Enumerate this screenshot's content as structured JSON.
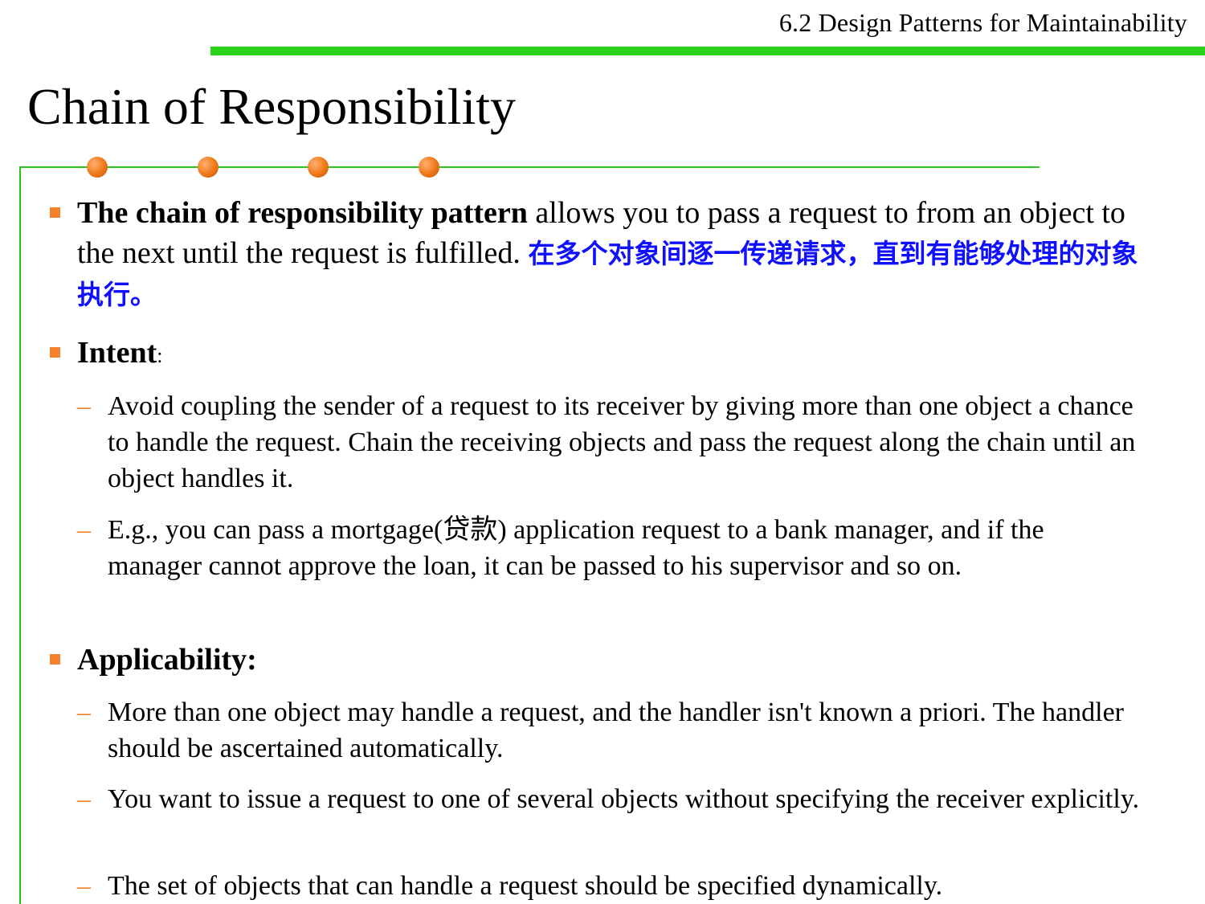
{
  "header": {
    "section": "6.2 Design Patterns for Maintainability",
    "title": "Chain of Responsibility"
  },
  "colors": {
    "accent_green": "#2bd31b",
    "bullet_orange": "#f5822a",
    "chinese_blue": "#1010ff"
  },
  "content": {
    "definition": {
      "bold": "The chain of responsibility pattern",
      "rest": " allows you to pass a request to from an object to the next until the request is fulfilled. ",
      "chinese": "在多个对象间逐一传递请求，直到有能够处理的对象执行。"
    },
    "intent": {
      "heading": "Intent",
      "colon": ":",
      "items": [
        "Avoid coupling the sender of a request to its receiver by giving more than one object a chance to handle the request. Chain the receiving objects and pass the request along the chain until an object handles it.",
        "E.g., you can pass a mortgage(贷款) application request to a bank manager, and if the manager cannot approve the loan, it can be passed to his supervisor and so on."
      ]
    },
    "applicability": {
      "heading": "Applicability:",
      "items": [
        "More than one object may handle a request, and the handler isn't known a priori. The handler should be ascertained automatically.",
        "You want to issue a request to one of several objects without specifying the receiver explicitly.",
        "The set of objects that can handle a request should be specified dynamically."
      ]
    },
    "dash_symbol": "–"
  }
}
